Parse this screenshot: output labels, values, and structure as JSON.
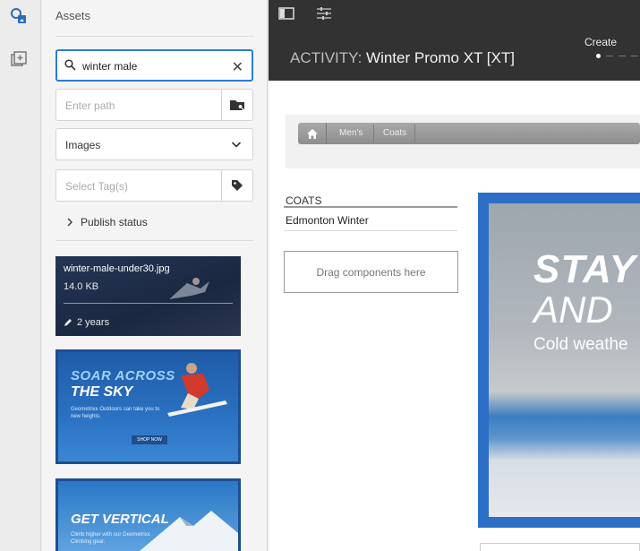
{
  "rail": {
    "icons": [
      "assets-finder-icon",
      "add-panel-icon"
    ]
  },
  "assets": {
    "title": "Assets",
    "search": {
      "value": "winter male"
    },
    "path": {
      "placeholder": "Enter path"
    },
    "type_filter": {
      "value": "Images"
    },
    "tags": {
      "placeholder": "Select Tag(s)"
    },
    "publish_status": "Publish status",
    "results": [
      {
        "name": "winter-male-under30.jpg",
        "size": "14.0 KB",
        "age": "2 years"
      },
      {
        "headline1": "SOAR ACROSS",
        "headline2": "THE SKY",
        "body": "Geometrixx Outdoors can take you to new heights.",
        "cta": "SHOP NOW"
      },
      {
        "headline1": "GET VERTICAL",
        "body": "Climb higher with our Geometrixx Climbing gear."
      }
    ]
  },
  "editor": {
    "activity_label": "ACTIVITY:",
    "activity_name": "Winter Promo XT [XT]",
    "create_label": "Create",
    "breadcrumb": [
      "Men's",
      "Coats"
    ],
    "section_title": "COATS",
    "item": "Edmonton Winter",
    "drag_hint": "Drag components here",
    "hero": {
      "line1": "STAY",
      "line2": "AND",
      "line3": "Cold weathe"
    }
  },
  "colors": {
    "accent": "#2d7dd2",
    "topbar": "#323232",
    "hero_frame": "#2d6fc6"
  }
}
